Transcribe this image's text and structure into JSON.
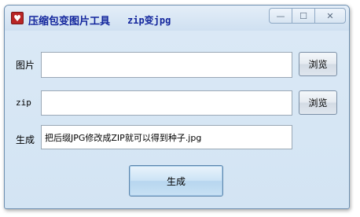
{
  "window": {
    "title": "压缩包变图片工具",
    "subtitle": "zip变jpg",
    "icon": "heart-icon"
  },
  "caption_buttons": {
    "minimize": "—",
    "maximize": "☐",
    "close": "✕"
  },
  "form": {
    "image_label": "图片",
    "image_value": "",
    "zip_label": "zip",
    "zip_value": "",
    "output_label": "生成",
    "output_value": "把后缀JPG修改成ZIP就可以得到种子.jpg",
    "browse_label": "浏览",
    "generate_label": "生成"
  },
  "colors": {
    "title_text": "#11249c",
    "window_bg": "#d7e6f4",
    "icon_bg": "#b92525"
  }
}
